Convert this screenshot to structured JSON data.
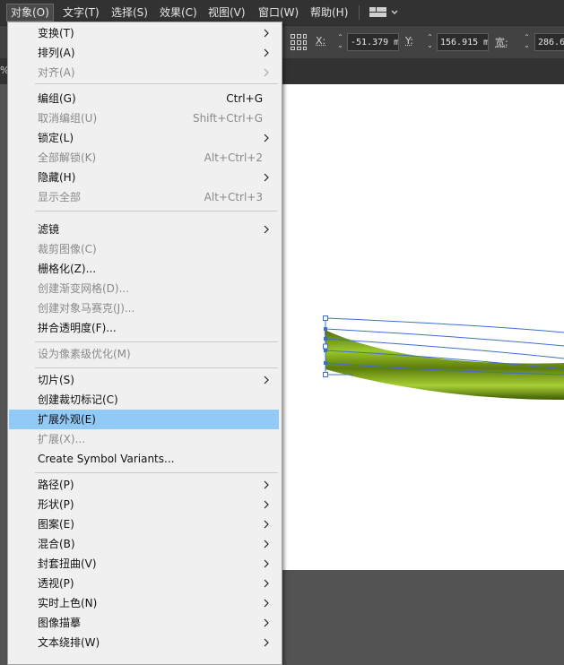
{
  "menubar": {
    "items": [
      "对象(O)",
      "文字(T)",
      "选择(S)",
      "效果(C)",
      "视图(V)",
      "窗口(W)",
      "帮助(H)"
    ]
  },
  "control_bar": {
    "x_label": "X:",
    "x_value": "-51.379 m",
    "y_label": "Y:",
    "y_value": "156.915 m",
    "w_label": "宽:",
    "w_value": "286.6"
  },
  "tab_prefix": "%",
  "object_menu": {
    "items": [
      {
        "label": "变换(T)",
        "shortcut": "",
        "submenu": true,
        "disabled": false
      },
      {
        "label": "排列(A)",
        "shortcut": "",
        "submenu": true,
        "disabled": false
      },
      {
        "label": "对齐(A)",
        "shortcut": "",
        "submenu": true,
        "disabled": true
      },
      {
        "label": "编组(G)",
        "shortcut": "Ctrl+G",
        "submenu": false,
        "disabled": false
      },
      {
        "label": "取消编组(U)",
        "shortcut": "Shift+Ctrl+G",
        "submenu": false,
        "disabled": true
      },
      {
        "label": "锁定(L)",
        "shortcut": "",
        "submenu": true,
        "disabled": false
      },
      {
        "label": "全部解锁(K)",
        "shortcut": "Alt+Ctrl+2",
        "submenu": false,
        "disabled": true
      },
      {
        "label": "隐藏(H)",
        "shortcut": "",
        "submenu": true,
        "disabled": false
      },
      {
        "label": "显示全部",
        "shortcut": "Alt+Ctrl+3",
        "submenu": false,
        "disabled": true
      },
      {
        "label": "滤镜",
        "shortcut": "",
        "submenu": true,
        "disabled": false
      },
      {
        "label": "裁剪图像(C)",
        "shortcut": "",
        "submenu": false,
        "disabled": true
      },
      {
        "label": "栅格化(Z)...",
        "shortcut": "",
        "submenu": false,
        "disabled": false
      },
      {
        "label": "创建渐变网格(D)...",
        "shortcut": "",
        "submenu": false,
        "disabled": true
      },
      {
        "label": "创建对象马赛克(J)...",
        "shortcut": "",
        "submenu": false,
        "disabled": true
      },
      {
        "label": "拼合透明度(F)...",
        "shortcut": "",
        "submenu": false,
        "disabled": false
      },
      {
        "label": "设为像素级优化(M)",
        "shortcut": "",
        "submenu": false,
        "disabled": true
      },
      {
        "label": "切片(S)",
        "shortcut": "",
        "submenu": true,
        "disabled": false
      },
      {
        "label": "创建裁切标记(C)",
        "shortcut": "",
        "submenu": false,
        "disabled": false
      },
      {
        "label": "扩展外观(E)",
        "shortcut": "",
        "submenu": false,
        "disabled": false
      },
      {
        "label": "扩展(X)...",
        "shortcut": "",
        "submenu": false,
        "disabled": true
      },
      {
        "label": "Create Symbol Variants...",
        "shortcut": "",
        "submenu": false,
        "disabled": false
      },
      {
        "label": "路径(P)",
        "shortcut": "",
        "submenu": true,
        "disabled": false
      },
      {
        "label": "形状(P)",
        "shortcut": "",
        "submenu": true,
        "disabled": false
      },
      {
        "label": "图案(E)",
        "shortcut": "",
        "submenu": true,
        "disabled": false
      },
      {
        "label": "混合(B)",
        "shortcut": "",
        "submenu": true,
        "disabled": false
      },
      {
        "label": "封套扭曲(V)",
        "shortcut": "",
        "submenu": true,
        "disabled": false
      },
      {
        "label": "透视(P)",
        "shortcut": "",
        "submenu": true,
        "disabled": false
      },
      {
        "label": "实时上色(N)",
        "shortcut": "",
        "submenu": true,
        "disabled": false
      },
      {
        "label": "图像描摹",
        "shortcut": "",
        "submenu": true,
        "disabled": false
      },
      {
        "label": "文本绕排(W)",
        "shortcut": "",
        "submenu": true,
        "disabled": false
      }
    ]
  },
  "colors": {
    "menubar_bg": "#323232",
    "dropdown_bg": "#f0f0f0",
    "highlight": "#91c9f7",
    "selection_blue": "#3b6fd1",
    "shape_green": "#7a9e1c"
  }
}
